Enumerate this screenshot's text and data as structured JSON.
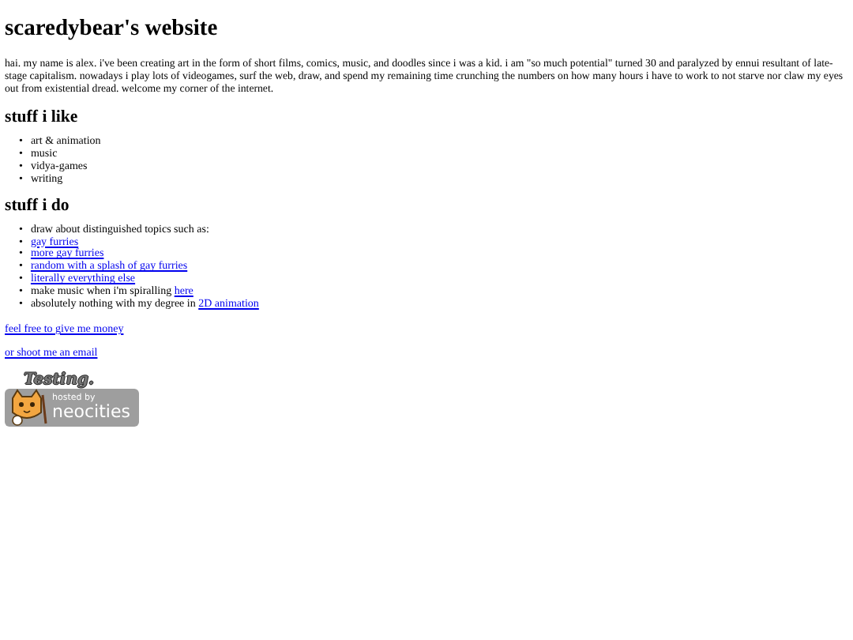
{
  "title": "scaredybear's website",
  "intro": "hai. my name is alex. i've been creating art in the form of short films, comics, music, and doodles since i was a kid. i am \"so much potential\" turned 30 and paralyzed by ennui resultant of late-stage capitalism. nowadays i play lots of videogames, surf the web, draw, and spend my remaining time crunching the numbers on how many hours i have to work to not starve nor claw my eyes out from existential dread. welcome my corner of the internet.",
  "sections": [
    {
      "heading": "stuff i like",
      "items": [
        {
          "marker": "•",
          "text": "art & animation"
        },
        {
          "marker": "•",
          "text": "music"
        },
        {
          "marker": "•",
          "text": "vidya-games"
        },
        {
          "marker": "•",
          "text": "writing"
        }
      ]
    },
    {
      "heading": "stuff i do",
      "items": [
        {
          "marker": "•",
          "text": "draw about distinguished topics such as:"
        },
        {
          "marker": "•",
          "link": "gay furries"
        },
        {
          "marker": "•",
          "link": "more gay furries"
        },
        {
          "marker": "•",
          "link": "random with a splash of gay furries"
        },
        {
          "marker": "•",
          "link": "literally everything else"
        },
        {
          "marker": "•",
          "text": "make music when i'm spiralling",
          "link": "here"
        },
        {
          "marker": "•",
          "text": "absolutely nothing with my degree in",
          "link": "2D animation"
        }
      ]
    }
  ],
  "links": [
    "feel free to give me money",
    "or shoot me an email"
  ],
  "badge": {
    "caption": "Testing.",
    "hosted_by": "hosted by",
    "name": "neocities"
  }
}
